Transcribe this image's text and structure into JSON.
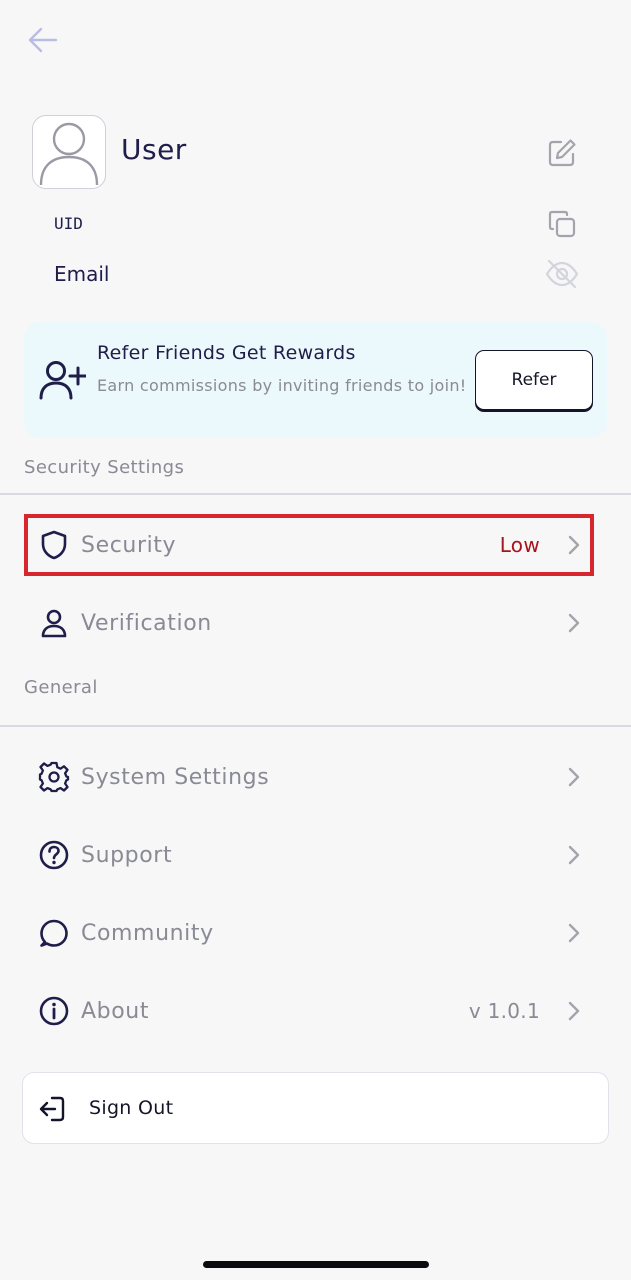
{
  "profile": {
    "name": "User",
    "uid_label": "UID",
    "email_label": "Email"
  },
  "refer": {
    "title": "Refer Friends Get Rewards",
    "description": "Earn commissions by inviting friends to join!",
    "button_label": "Refer"
  },
  "sections": {
    "security_title": "Security Settings",
    "general_title": "General"
  },
  "menu": {
    "security": {
      "label": "Security",
      "value": "Low",
      "value_color": "#a8141c"
    },
    "verification": {
      "label": "Verification"
    },
    "system_settings": {
      "label": "System Settings"
    },
    "support": {
      "label": "Support"
    },
    "community": {
      "label": "Community"
    },
    "about": {
      "label": "About",
      "value": "v 1.0.1"
    }
  },
  "signout": {
    "label": "Sign Out"
  },
  "colors": {
    "text_primary": "#1f1d4a",
    "text_muted": "#8a8a95",
    "refer_bg": "#ecf9fc",
    "highlight": "#d7262d",
    "status_low": "#a8141c"
  },
  "icons": {
    "back": "arrow-left-icon",
    "avatar": "user-placeholder-icon",
    "edit": "edit-icon",
    "copy": "copy-icon",
    "hide": "eye-off-icon",
    "refer": "user-plus-icon",
    "security": "shield-icon",
    "verification": "user-icon",
    "system_settings": "gear-icon",
    "support": "help-circle-icon",
    "community": "chat-bubble-icon",
    "about": "info-icon",
    "signout": "sign-out-icon",
    "chevron": "chevron-right-icon"
  }
}
